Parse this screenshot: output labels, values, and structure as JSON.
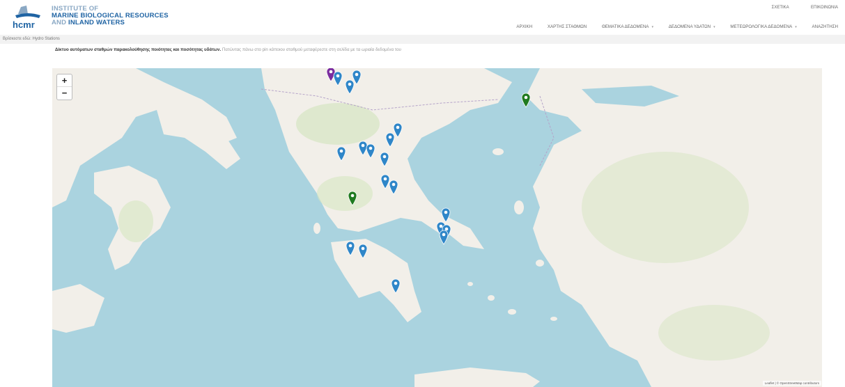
{
  "header": {
    "inst_line1": "INSTITUTE OF",
    "inst_line2": "MARINE BIOLOGICAL RESOURCES",
    "inst_line3_a": "AND ",
    "inst_line3_b": "INLAND WATERS",
    "logo_text": "hcmr",
    "top_links": [
      "ΣΧΕΤΙΚΑ",
      "ΕΠΙΚΟΙΝΩΝΙΑ"
    ],
    "nav": [
      {
        "label": "ΑΡΧΙΚΗ",
        "dropdown": false
      },
      {
        "label": "ΧΑΡΤΗΣ ΣΤΑΘΜΩΝ",
        "dropdown": false
      },
      {
        "label": "ΘΕΜΑΤΙΚΑ ΔΕΔΟΜΕΝΑ",
        "dropdown": true
      },
      {
        "label": "ΔΕΔΟΜΕΝΑ ΥΔΑΤΩΝ",
        "dropdown": true
      },
      {
        "label": "ΜΕΤΕΩΡΟΛΟΓΙΚΑ ΔΕΔΟΜΕΝΑ",
        "dropdown": true
      },
      {
        "label": "ΑΝΑΖΗΤΗΣΗ",
        "dropdown": false
      }
    ]
  },
  "breadcrumb": "Βρίσκεστε εδώ: Hydro Stations",
  "description": {
    "bold": "Δίκτυο αυτόματων σταθμών παρακολούθησης ποιότητας και ποσότητας υδάτων.",
    "normal": " Πατώντας πάνω στο pin κάποιου σταθμού μεταφέρεστε στη σελίδα με τα ωριαία δεδομένα του"
  },
  "map": {
    "zoom_in": "+",
    "zoom_out": "−",
    "attribution": "Leaflet | © OpenStreetMap contributors",
    "colors": {
      "sea": "#aad3df",
      "land": "#f2efe9",
      "green_area": "#cfe3b8",
      "blue_marker": "#2f86c8",
      "green_marker": "#1f7a1f",
      "purple_marker": "#7a2c9e"
    }
  },
  "markers": [
    {
      "color": "purple",
      "label": "station"
    },
    {
      "color": "blue",
      "label": "station"
    },
    {
      "color": "blue",
      "label": "station"
    },
    {
      "color": "blue",
      "label": "station"
    },
    {
      "color": "green",
      "label": "station"
    },
    {
      "color": "blue",
      "label": "station"
    },
    {
      "color": "blue",
      "label": "station"
    },
    {
      "color": "blue",
      "label": "station"
    },
    {
      "color": "blue",
      "label": "station"
    },
    {
      "color": "blue",
      "label": "station"
    },
    {
      "color": "blue",
      "label": "station"
    },
    {
      "color": "blue",
      "label": "station"
    },
    {
      "color": "green",
      "label": "station"
    },
    {
      "color": "blue",
      "label": "station"
    },
    {
      "color": "blue",
      "label": "station"
    },
    {
      "color": "blue",
      "label": "station"
    },
    {
      "color": "blue",
      "label": "station"
    },
    {
      "color": "blue",
      "label": "station"
    },
    {
      "color": "blue",
      "label": "station"
    },
    {
      "color": "blue",
      "label": "station"
    },
    {
      "color": "blue",
      "label": "station"
    }
  ]
}
